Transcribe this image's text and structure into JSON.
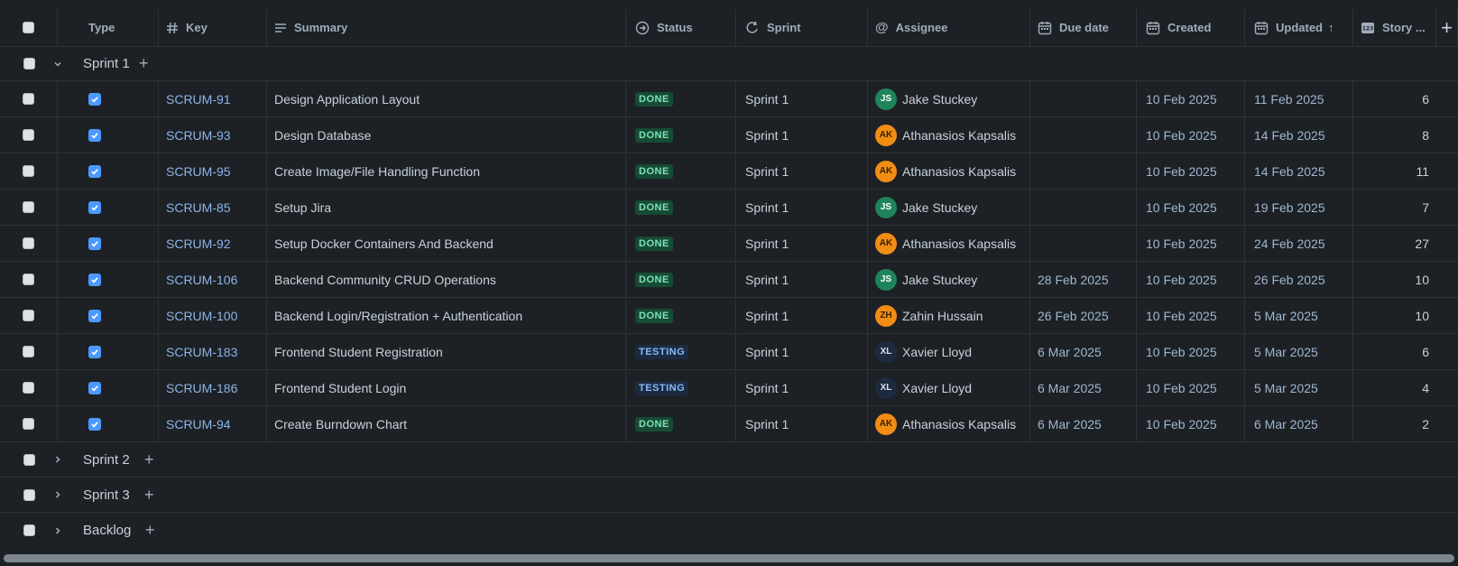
{
  "columns": {
    "type": "Type",
    "key": "Key",
    "summary": "Summary",
    "status": "Status",
    "sprint": "Sprint",
    "assignee": "Assignee",
    "due": "Due date",
    "created": "Created",
    "updated": "Updated",
    "sort_indicator": "↑",
    "story": "Story ...",
    "add": "+"
  },
  "groups": {
    "sprint1": {
      "name": "Sprint 1",
      "add": "+"
    },
    "sprint2": {
      "name": "Sprint 2",
      "add": "+"
    },
    "sprint3": {
      "name": "Sprint 3",
      "add": "+"
    },
    "backlog": {
      "name": "Backlog",
      "add": "+"
    }
  },
  "rows": [
    {
      "key": "SCRUM-91",
      "summary": "Design Application Layout",
      "status": "DONE",
      "sprint": "Sprint 1",
      "initials": "JS",
      "assignee": "Jake Stuckey",
      "due": "",
      "created": "10 Feb 2025",
      "updated": "11 Feb 2025",
      "points": "6"
    },
    {
      "key": "SCRUM-93",
      "summary": "Design Database",
      "status": "DONE",
      "sprint": "Sprint 1",
      "initials": "AK",
      "assignee": "Athanasios Kapsalis",
      "due": "",
      "created": "10 Feb 2025",
      "updated": "14 Feb 2025",
      "points": "8"
    },
    {
      "key": "SCRUM-95",
      "summary": "Create Image/File Handling Function",
      "status": "DONE",
      "sprint": "Sprint 1",
      "initials": "AK",
      "assignee": "Athanasios Kapsalis",
      "due": "",
      "created": "10 Feb 2025",
      "updated": "14 Feb 2025",
      "points": "11"
    },
    {
      "key": "SCRUM-85",
      "summary": "Setup Jira",
      "status": "DONE",
      "sprint": "Sprint 1",
      "initials": "JS",
      "assignee": "Jake Stuckey",
      "due": "",
      "created": "10 Feb 2025",
      "updated": "19 Feb 2025",
      "points": "7"
    },
    {
      "key": "SCRUM-92",
      "summary": "Setup Docker Containers And Backend",
      "status": "DONE",
      "sprint": "Sprint 1",
      "initials": "AK",
      "assignee": "Athanasios Kapsalis",
      "due": "",
      "created": "10 Feb 2025",
      "updated": "24 Feb 2025",
      "points": "27"
    },
    {
      "key": "SCRUM-106",
      "summary": "Backend Community CRUD Operations",
      "status": "DONE",
      "sprint": "Sprint 1",
      "initials": "JS",
      "assignee": "Jake Stuckey",
      "due": "28 Feb 2025",
      "created": "10 Feb 2025",
      "updated": "26 Feb 2025",
      "points": "10"
    },
    {
      "key": "SCRUM-100",
      "summary": "Backend Login/Registration + Authentication",
      "status": "DONE",
      "sprint": "Sprint 1",
      "initials": "ZH",
      "assignee": "Zahin Hussain",
      "due": "26 Feb 2025",
      "created": "10 Feb 2025",
      "updated": "5 Mar 2025",
      "points": "10"
    },
    {
      "key": "SCRUM-183",
      "summary": "Frontend Student Registration",
      "status": "TESTING",
      "sprint": "Sprint 1",
      "initials": "XL",
      "assignee": "Xavier Lloyd",
      "due": "6 Mar 2025",
      "created": "10 Feb 2025",
      "updated": "5 Mar 2025",
      "points": "6"
    },
    {
      "key": "SCRUM-186",
      "summary": "Frontend Student Login",
      "status": "TESTING",
      "sprint": "Sprint 1",
      "initials": "XL",
      "assignee": "Xavier Lloyd",
      "due": "6 Mar 2025",
      "created": "10 Feb 2025",
      "updated": "5 Mar 2025",
      "points": "4"
    },
    {
      "key": "SCRUM-94",
      "summary": "Create Burndown Chart",
      "status": "DONE",
      "sprint": "Sprint 1",
      "initials": "AK",
      "assignee": "Athanasios Kapsalis",
      "due": "6 Mar 2025",
      "created": "10 Feb 2025",
      "updated": "6 Mar 2025",
      "points": "2"
    }
  ],
  "avatar_colors": {
    "JS": "#1f845a",
    "AK": "#f18d13",
    "ZH": "#f18d13",
    "XL": "#1c2b41"
  },
  "avatar_text_colors": {
    "JS": "#ffffff",
    "AK": "#3b2000",
    "ZH": "#3b2000",
    "XL": "#dfe1e6"
  },
  "status_classes": {
    "DONE": "lz-done",
    "TESTING": "lz-testing"
  }
}
